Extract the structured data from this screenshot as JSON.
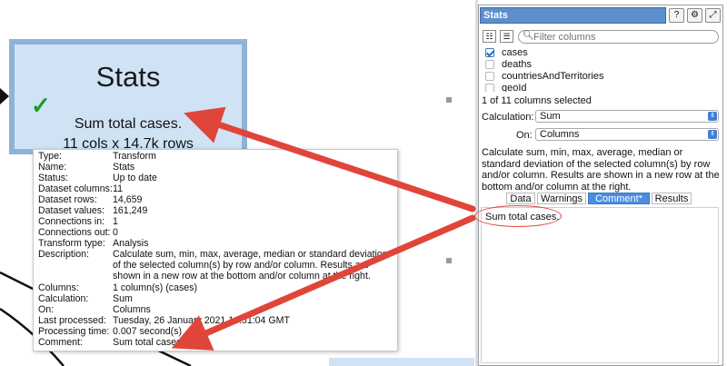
{
  "canvas": {
    "node": {
      "title": "Stats",
      "line1": "Sum total cases.",
      "line2": "11 cols x 14.7k rows"
    },
    "tooltip": {
      "rows": [
        {
          "key": "Type:",
          "value": "Transform"
        },
        {
          "key": "Name:",
          "value": "Stats"
        },
        {
          "key": "Status:",
          "value": "Up to date"
        },
        {
          "key": "Dataset columns:",
          "value": "11"
        },
        {
          "key": "Dataset rows:",
          "value": "14,659"
        },
        {
          "key": "Dataset values:",
          "value": "161,249"
        },
        {
          "key": "Connections in:",
          "value": "1"
        },
        {
          "key": "Connections out:",
          "value": "0"
        },
        {
          "key": "Transform type:",
          "value": "Analysis"
        },
        {
          "key": "Description:",
          "value": "Calculate sum, min, max, average, median or standard deviation of the selected column(s) by row and/or column. Results are shown in a new row at the bottom and/or column at the right."
        },
        {
          "key": "Columns:",
          "value": "1 column(s) (cases)"
        },
        {
          "key": "Calculation:",
          "value": "Sum"
        },
        {
          "key": "On:",
          "value": "Columns"
        },
        {
          "key": "Last processed:",
          "value": "Tuesday, 26 January 2021 14:51:04 GMT"
        },
        {
          "key": "Processing time:",
          "value": "0.007 second(s)"
        },
        {
          "key": "Comment:",
          "value": "Sum total cases."
        }
      ]
    },
    "annotation_color": "#e0453a"
  },
  "panel": {
    "title": "Stats",
    "help_btn": "?",
    "settings_btn": "⚙",
    "expand_btn": "⤢",
    "filter_placeholder": "Filter columns",
    "columns": [
      {
        "label": "cases",
        "checked": true
      },
      {
        "label": "deaths",
        "checked": false
      },
      {
        "label": "countriesAndTerritories",
        "checked": false
      },
      {
        "label": "geoId",
        "checked": false
      }
    ],
    "selection_info": "1 of 11 columns selected",
    "calculation_label": "Calculation:",
    "calculation_value": "Sum",
    "on_label": "On:",
    "on_value": "Columns",
    "help_text": "Calculate sum, min, max, average, median or standard deviation of the selected column(s) by row and/or column. Results are shown in a new row at the bottom and/or column at the right.",
    "tabs": [
      "Data",
      "Warnings",
      "Comment*",
      "Results"
    ],
    "active_tab": "Comment*",
    "comment": "Sum total cases."
  }
}
